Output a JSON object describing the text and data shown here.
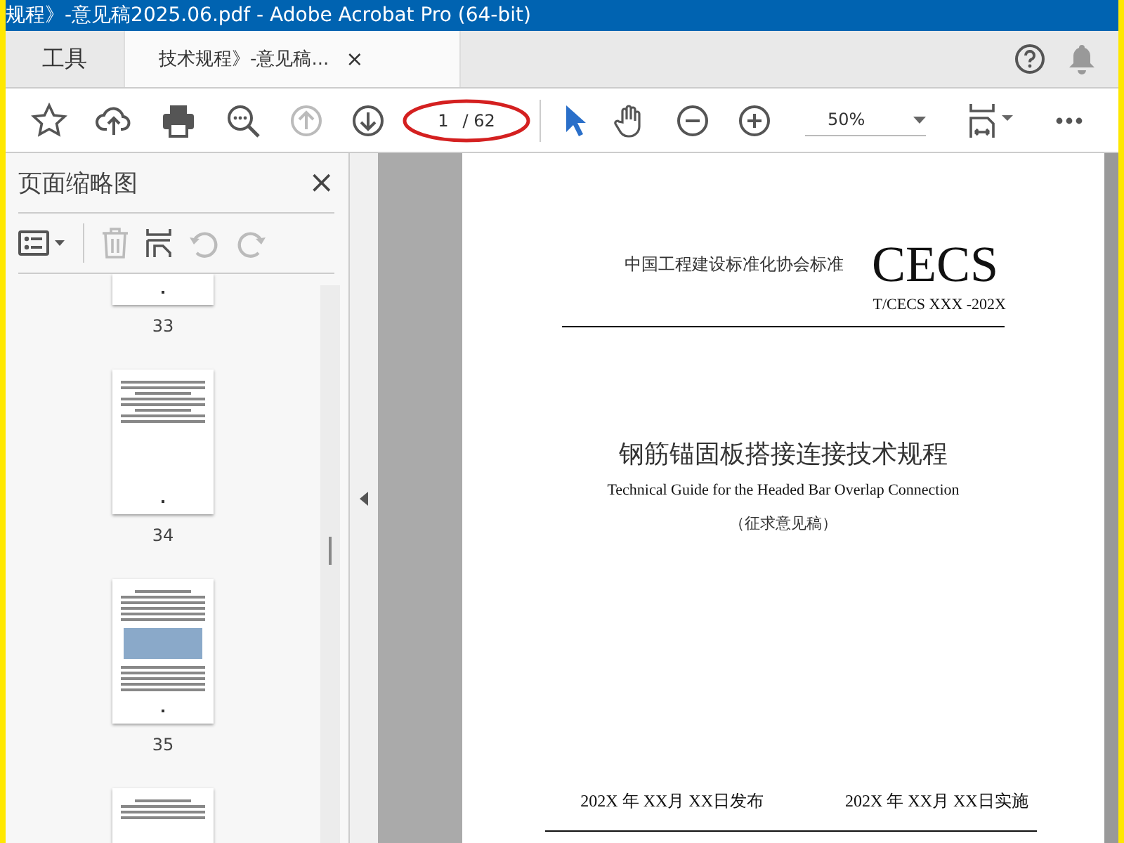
{
  "window": {
    "title": "规程》-意见稿2025.06.pdf - Adobe Acrobat Pro (64-bit)"
  },
  "tabs": [
    {
      "label": "工具",
      "selected": false
    },
    {
      "label": "技术规程》-意见稿...",
      "selected": true,
      "close": "×"
    }
  ],
  "toolbar": {
    "page_number": "1",
    "page_total": "/ 62",
    "zoom": "50%",
    "page_annotation": true
  },
  "sidebar": {
    "title": "页面缩略图",
    "close": "×",
    "thumbnails": [
      {
        "label": "33",
        "kind": "cut"
      },
      {
        "label": "34",
        "kind": "text"
      },
      {
        "label": "35",
        "kind": "figure"
      },
      {
        "kind": "partial"
      }
    ]
  },
  "document": {
    "organization": "中国工程建设标准化协会标准",
    "logo": "CECS",
    "code": "T/CECS XXX -202X",
    "title": "钢筋锚固板搭接连接技术规程",
    "subtitle": "Technical Guide for the Headed Bar Overlap Connection",
    "note": "（征求意见稿）",
    "publish_date": "202X 年 XX月 XX日发布",
    "effective_date": "202X 年 XX月 XX日实施"
  }
}
